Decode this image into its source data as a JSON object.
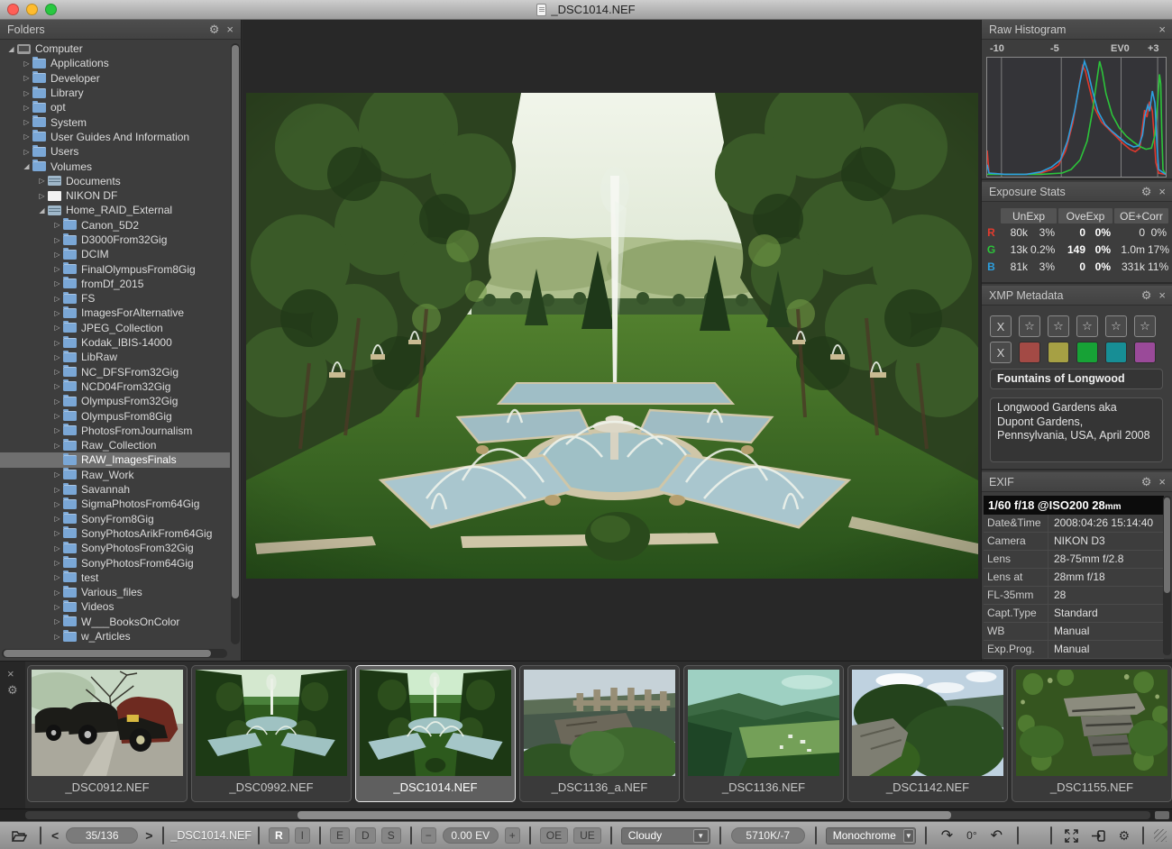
{
  "window": {
    "title": "_DSC1014.NEF"
  },
  "icons": {
    "gear": "⚙",
    "close": "×",
    "expand": "▷",
    "collapse": "◢",
    "star": "☆",
    "clear": "X",
    "prev": "<",
    "next": ">",
    "minus": "−",
    "plus": "+",
    "dropdown": "▼",
    "redo": "↷",
    "undo": "↶"
  },
  "folders_panel": {
    "title": "Folders",
    "tree": [
      {
        "label": "Computer",
        "level": 0,
        "state": "expanded",
        "icon": "computer"
      },
      {
        "label": "Applications",
        "level": 1,
        "state": "collapsed",
        "icon": "folder"
      },
      {
        "label": "Developer",
        "level": 1,
        "state": "collapsed",
        "icon": "folder"
      },
      {
        "label": "Library",
        "level": 1,
        "state": "collapsed",
        "icon": "folder"
      },
      {
        "label": "opt",
        "level": 1,
        "state": "collapsed",
        "icon": "folder"
      },
      {
        "label": "System",
        "level": 1,
        "state": "collapsed",
        "icon": "folder"
      },
      {
        "label": "User Guides And Information",
        "level": 1,
        "state": "collapsed",
        "icon": "folder"
      },
      {
        "label": "Users",
        "level": 1,
        "state": "collapsed",
        "icon": "folder"
      },
      {
        "label": "Volumes",
        "level": 1,
        "state": "expanded",
        "icon": "folder"
      },
      {
        "label": "Documents",
        "level": 2,
        "state": "collapsed",
        "icon": "drive"
      },
      {
        "label": "NIKON DF",
        "level": 2,
        "state": "collapsed",
        "icon": "disk"
      },
      {
        "label": "Home_RAID_External",
        "level": 2,
        "state": "expanded",
        "icon": "drive"
      },
      {
        "label": "Canon_5D2",
        "level": 3,
        "state": "collapsed",
        "icon": "folder"
      },
      {
        "label": "D3000From32Gig",
        "level": 3,
        "state": "collapsed",
        "icon": "folder"
      },
      {
        "label": "DCIM",
        "level": 3,
        "state": "collapsed",
        "icon": "folder"
      },
      {
        "label": "FinalOlympusFrom8Gig",
        "level": 3,
        "state": "collapsed",
        "icon": "folder"
      },
      {
        "label": "fromDf_2015",
        "level": 3,
        "state": "collapsed",
        "icon": "folder"
      },
      {
        "label": "FS",
        "level": 3,
        "state": "collapsed",
        "icon": "folder"
      },
      {
        "label": "ImagesForAlternative",
        "level": 3,
        "state": "collapsed",
        "icon": "folder"
      },
      {
        "label": "JPEG_Collection",
        "level": 3,
        "state": "collapsed",
        "icon": "folder"
      },
      {
        "label": "Kodak_IBIS-14000",
        "level": 3,
        "state": "collapsed",
        "icon": "folder"
      },
      {
        "label": "LibRaw",
        "level": 3,
        "state": "collapsed",
        "icon": "folder"
      },
      {
        "label": "NC_DFSFrom32Gig",
        "level": 3,
        "state": "collapsed",
        "icon": "folder"
      },
      {
        "label": "NCD04From32Gig",
        "level": 3,
        "state": "collapsed",
        "icon": "folder"
      },
      {
        "label": "OlympusFrom32Gig",
        "level": 3,
        "state": "collapsed",
        "icon": "folder"
      },
      {
        "label": "OlympusFrom8Gig",
        "level": 3,
        "state": "collapsed",
        "icon": "folder"
      },
      {
        "label": "PhotosFromJournalism",
        "level": 3,
        "state": "collapsed",
        "icon": "folder"
      },
      {
        "label": "Raw_Collection",
        "level": 3,
        "state": "collapsed",
        "icon": "folder"
      },
      {
        "label": "RAW_ImagesFinals",
        "level": 3,
        "state": "leaf",
        "icon": "folder",
        "selected": true
      },
      {
        "label": "Raw_Work",
        "level": 3,
        "state": "collapsed",
        "icon": "folder"
      },
      {
        "label": "Savannah",
        "level": 3,
        "state": "collapsed",
        "icon": "folder"
      },
      {
        "label": "SigmaPhotosFrom64Gig",
        "level": 3,
        "state": "collapsed",
        "icon": "folder"
      },
      {
        "label": "SonyFrom8Gig",
        "level": 3,
        "state": "collapsed",
        "icon": "folder"
      },
      {
        "label": "SonyPhotosArikFrom64Gig",
        "level": 3,
        "state": "collapsed",
        "icon": "folder"
      },
      {
        "label": "SonyPhotosFrom32Gig",
        "level": 3,
        "state": "collapsed",
        "icon": "folder"
      },
      {
        "label": "SonyPhotosFrom64Gig",
        "level": 3,
        "state": "collapsed",
        "icon": "folder"
      },
      {
        "label": "test",
        "level": 3,
        "state": "collapsed",
        "icon": "folder"
      },
      {
        "label": "Various_files",
        "level": 3,
        "state": "collapsed",
        "icon": "folder"
      },
      {
        "label": "Videos",
        "level": 3,
        "state": "collapsed",
        "icon": "folder"
      },
      {
        "label": "W___BooksOnColor",
        "level": 3,
        "state": "collapsed",
        "icon": "folder"
      },
      {
        "label": "w_Articles",
        "level": 3,
        "state": "collapsed",
        "icon": "folder"
      }
    ]
  },
  "histogram_panel": {
    "title": "Raw Histogram",
    "chart_data": {
      "type": "line",
      "xlabel": "EV",
      "tick_labels": [
        "-10",
        "-5",
        "EV0",
        "+3"
      ],
      "tick_fracs": [
        0.08,
        0.415,
        0.75,
        0.955
      ],
      "grid": true,
      "legend": "none",
      "series": [
        {
          "name": "red",
          "color": "#df382c",
          "points": [
            [
              0,
              0.22
            ],
            [
              0.01,
              0.03
            ],
            [
              0.1,
              0.02
            ],
            [
              0.2,
              0.02
            ],
            [
              0.3,
              0.03
            ],
            [
              0.36,
              0.06
            ],
            [
              0.4,
              0.1
            ],
            [
              0.44,
              0.22
            ],
            [
              0.48,
              0.45
            ],
            [
              0.51,
              0.72
            ],
            [
              0.535,
              0.93
            ],
            [
              0.55,
              0.89
            ],
            [
              0.57,
              0.76
            ],
            [
              0.6,
              0.58
            ],
            [
              0.64,
              0.46
            ],
            [
              0.68,
              0.4
            ],
            [
              0.72,
              0.34
            ],
            [
              0.76,
              0.28
            ],
            [
              0.8,
              0.23
            ],
            [
              0.83,
              0.21
            ],
            [
              0.855,
              0.24
            ],
            [
              0.87,
              0.42
            ],
            [
              0.882,
              0.56
            ],
            [
              0.895,
              0.5
            ],
            [
              0.91,
              0.63
            ],
            [
              0.925,
              0.55
            ],
            [
              0.935,
              0.35
            ],
            [
              0.945,
              0.12
            ],
            [
              0.96,
              0.03
            ],
            [
              1,
              0.02
            ]
          ]
        },
        {
          "name": "green",
          "color": "#2cc43a",
          "points": [
            [
              0,
              0.02
            ],
            [
              0.3,
              0.02
            ],
            [
              0.42,
              0.03
            ],
            [
              0.47,
              0.06
            ],
            [
              0.52,
              0.14
            ],
            [
              0.56,
              0.3
            ],
            [
              0.59,
              0.55
            ],
            [
              0.615,
              0.82
            ],
            [
              0.63,
              0.97
            ],
            [
              0.645,
              0.88
            ],
            [
              0.665,
              0.7
            ],
            [
              0.7,
              0.52
            ],
            [
              0.74,
              0.41
            ],
            [
              0.78,
              0.34
            ],
            [
              0.82,
              0.29
            ],
            [
              0.86,
              0.25
            ],
            [
              0.89,
              0.23
            ],
            [
              0.92,
              0.24
            ],
            [
              0.94,
              0.35
            ],
            [
              0.955,
              0.62
            ],
            [
              0.965,
              0.86
            ],
            [
              0.972,
              0.78
            ],
            [
              0.978,
              0.4
            ],
            [
              0.985,
              0.06
            ],
            [
              1,
              0.02
            ]
          ]
        },
        {
          "name": "blue",
          "color": "#2c9fdf",
          "points": [
            [
              0,
              0.1
            ],
            [
              0.01,
              0.03
            ],
            [
              0.1,
              0.02
            ],
            [
              0.22,
              0.02
            ],
            [
              0.3,
              0.04
            ],
            [
              0.36,
              0.08
            ],
            [
              0.41,
              0.14
            ],
            [
              0.45,
              0.3
            ],
            [
              0.49,
              0.55
            ],
            [
              0.52,
              0.8
            ],
            [
              0.545,
              0.97
            ],
            [
              0.565,
              0.88
            ],
            [
              0.59,
              0.72
            ],
            [
              0.62,
              0.55
            ],
            [
              0.66,
              0.44
            ],
            [
              0.7,
              0.38
            ],
            [
              0.74,
              0.33
            ],
            [
              0.78,
              0.28
            ],
            [
              0.82,
              0.25
            ],
            [
              0.85,
              0.26
            ],
            [
              0.87,
              0.35
            ],
            [
              0.885,
              0.52
            ],
            [
              0.9,
              0.6
            ],
            [
              0.91,
              0.55
            ],
            [
              0.925,
              0.72
            ],
            [
              0.94,
              0.62
            ],
            [
              0.95,
              0.3
            ],
            [
              0.96,
              0.06
            ],
            [
              1,
              0.02
            ]
          ]
        }
      ]
    }
  },
  "exposure_panel": {
    "title": "Exposure Stats",
    "columns": [
      "UnExp",
      "OveExp",
      "OE+Corr"
    ],
    "rows": [
      {
        "channel": "R",
        "color": "#e23b2e",
        "cells": [
          "80k",
          "3%",
          "0",
          "0%",
          "0",
          "0%"
        ]
      },
      {
        "channel": "G",
        "color": "#2cc43a",
        "cells": [
          "13k",
          "0.2%",
          "149",
          "0%",
          "1.0m",
          "17%"
        ]
      },
      {
        "channel": "B",
        "color": "#2c9fdf",
        "cells": [
          "81k",
          "3%",
          "0",
          "0%",
          "331k",
          "11%"
        ]
      }
    ]
  },
  "xmp_panel": {
    "title": "XMP Metadata",
    "rating_clear": "X",
    "stars": [
      "☆",
      "☆",
      "☆",
      "☆",
      "☆"
    ],
    "label_clear": "X",
    "label_colors": [
      "#a34a45",
      "#a6a044",
      "#17a236",
      "#178e95",
      "#9a4a99"
    ],
    "title_value": "Fountains of Longwood",
    "description_value": "Longwood Gardens aka Dupont Gardens, Pennsylvania, USA, April 2008"
  },
  "exif_panel": {
    "title": "EXIF",
    "summary_main": "1/60 f/18 @ISO200 28",
    "summary_unit": "mm",
    "rows": [
      {
        "label": "Date&Time",
        "value": "2008:04:26 15:14:40"
      },
      {
        "label": "Camera",
        "value": "NIKON D3"
      },
      {
        "label": "Lens",
        "value": "28-75mm f/2.8"
      },
      {
        "label": "Lens at",
        "value": "28mm f/18"
      },
      {
        "label": "FL-35mm",
        "value": "28"
      },
      {
        "label": "Capt.Type",
        "value": "Standard"
      },
      {
        "label": "WB",
        "value": "Manual"
      },
      {
        "label": "Exp.Prog.",
        "value": "Manual"
      }
    ]
  },
  "filmstrip": {
    "items": [
      {
        "name": "_DSC0912.NEF",
        "scene": "cars",
        "selected": false
      },
      {
        "name": "_DSC0992.NEF",
        "scene": "garden",
        "selected": false
      },
      {
        "name": "_DSC1014.NEF",
        "scene": "garden2",
        "selected": true
      },
      {
        "name": "_DSC1136_a.NEF",
        "scene": "overlook",
        "selected": false
      },
      {
        "name": "_DSC1136.NEF",
        "scene": "valley",
        "selected": false
      },
      {
        "name": "_DSC1142.NEF",
        "scene": "cliff",
        "selected": false
      },
      {
        "name": "_DSC1155.NEF",
        "scene": "rocks",
        "selected": false
      }
    ]
  },
  "statusbar": {
    "counter": "35/136",
    "filename": "_DSC1014.NEF",
    "btn_r": "R",
    "btn_i": "I",
    "btn_e": "E",
    "btn_d": "D",
    "btn_s": "S",
    "ev_value": "0.00 EV",
    "btn_oe": "OE",
    "btn_ue": "UE",
    "wb_preset": "Cloudy",
    "wb_value": "5710K/-7",
    "render_mode": "Monochrome",
    "rotation": "0°"
  }
}
